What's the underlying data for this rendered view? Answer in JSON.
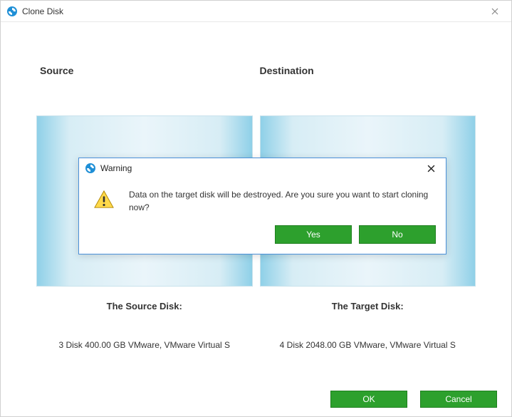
{
  "window": {
    "title": "Clone Disk"
  },
  "columns": {
    "source_heading": "Source",
    "dest_heading": "Destination",
    "source_label": "The Source Disk:",
    "target_label": "The Target Disk:",
    "source_desc": "3 Disk 400.00 GB VMware,  VMware Virtual S",
    "target_desc": "4 Disk 2048.00 GB VMware,  VMware Virtual S"
  },
  "footer": {
    "ok": "OK",
    "cancel": "Cancel"
  },
  "modal": {
    "title": "Warning",
    "message": "Data on the target disk will be destroyed. Are you sure you want to start cloning now?",
    "yes": "Yes",
    "no": "No"
  }
}
